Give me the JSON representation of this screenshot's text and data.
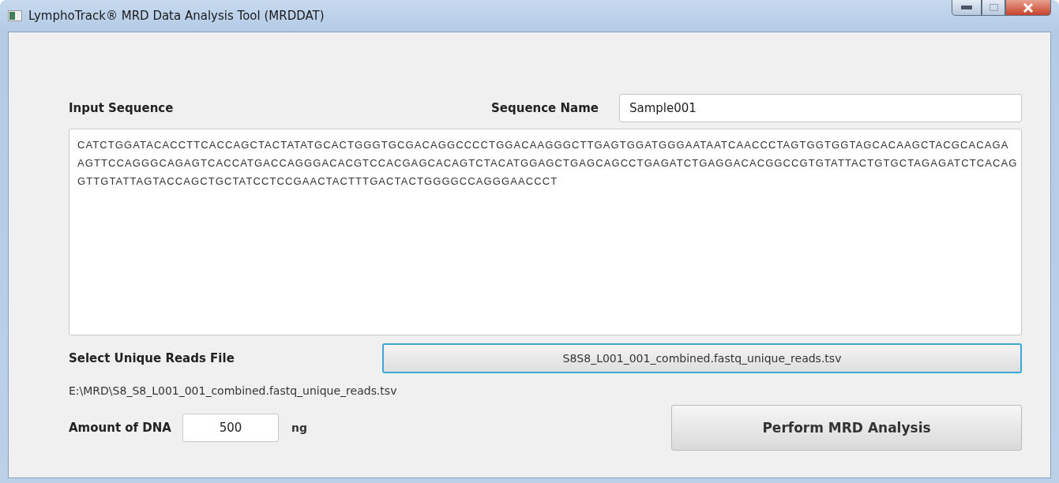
{
  "window": {
    "title": "LymphoTrack® MRD Data Analysis Tool (MRDDAT)"
  },
  "input_sequence": {
    "label": "Input Sequence",
    "lines": [
      "CATCTGGATACACCTTCACCAGCTACTATATGCACTGGGTGCGACAGGCCCCTGGACAAGGGCTTGAGTGGATGGGAATAATCAACCCTAGTGGTGGTAGCACAAGCTACGCACAGA",
      "AGTTCCAGGGCAGAGTCACCATGACCAGGGACACGTCCACGAGCACAGTCTACATGGAGCTGAGCAGCCTGAGATCTGAGGACACGGCCGTGTATTACTGTGCTAGAGATCTCACAG",
      "GTTGTATTAGTACCAGCTGCTATCCTCCGAACTACTTTGACTACTGGGGCCAGGGAACCCT"
    ]
  },
  "sequence_name": {
    "label": "Sequence Name",
    "value": "Sample001"
  },
  "unique_reads": {
    "label": "Select Unique Reads File",
    "button": "S8S8_L001_001_combined.fastq_unique_reads.tsv",
    "focused": true,
    "path": "E:\\MRD\\S8_S8_L001_001_combined.fastq_unique_reads.tsv"
  },
  "dna": {
    "label": "Amount of DNA",
    "value": "500",
    "unit": "ng"
  },
  "action": {
    "label": "Perform MRD Analysis"
  }
}
